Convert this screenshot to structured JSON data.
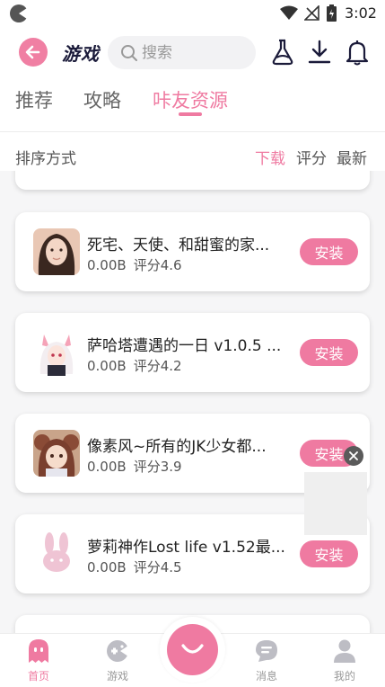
{
  "status_bar": {
    "time": "3:02"
  },
  "header": {
    "title": "游戏",
    "search_placeholder": "搜索"
  },
  "tabs": [
    {
      "label": "推荐",
      "active": false
    },
    {
      "label": "攻略",
      "active": false
    },
    {
      "label": "咔友资源",
      "active": true
    }
  ],
  "sort": {
    "label": "排序方式",
    "options": [
      {
        "label": "下载",
        "active": true
      },
      {
        "label": "评分",
        "active": false
      },
      {
        "label": "最新",
        "active": false
      }
    ]
  },
  "games": [
    {
      "title": "死宅、天使、和甜蜜的家...",
      "size": "0.00B",
      "rating": "评分4.6",
      "install_label": "安装"
    },
    {
      "title": "萨哈塔遭遇的一日 v1.0.5 ...",
      "size": "0.00B",
      "rating": "评分4.2",
      "install_label": "安装"
    },
    {
      "title": "像素风~所有的JK少女都...",
      "size": "0.00B",
      "rating": "评分3.9",
      "install_label": "安装"
    },
    {
      "title": "萝莉神作Lost life v1.52最...",
      "size": "0.00B",
      "rating": "评分4.5",
      "install_label": "安装"
    }
  ],
  "bottom_nav": [
    {
      "label": "首页",
      "icon": "ghost-icon",
      "active": true
    },
    {
      "label": "游戏",
      "icon": "gamepad-icon",
      "active": false
    },
    {
      "label": "消息",
      "icon": "chat-icon",
      "active": false
    },
    {
      "label": "我的",
      "icon": "person-icon",
      "active": false
    }
  ],
  "colors": {
    "accent": "#ef7aa1",
    "icon_dark": "#1b1b3a",
    "background": "#f6f6f7"
  }
}
